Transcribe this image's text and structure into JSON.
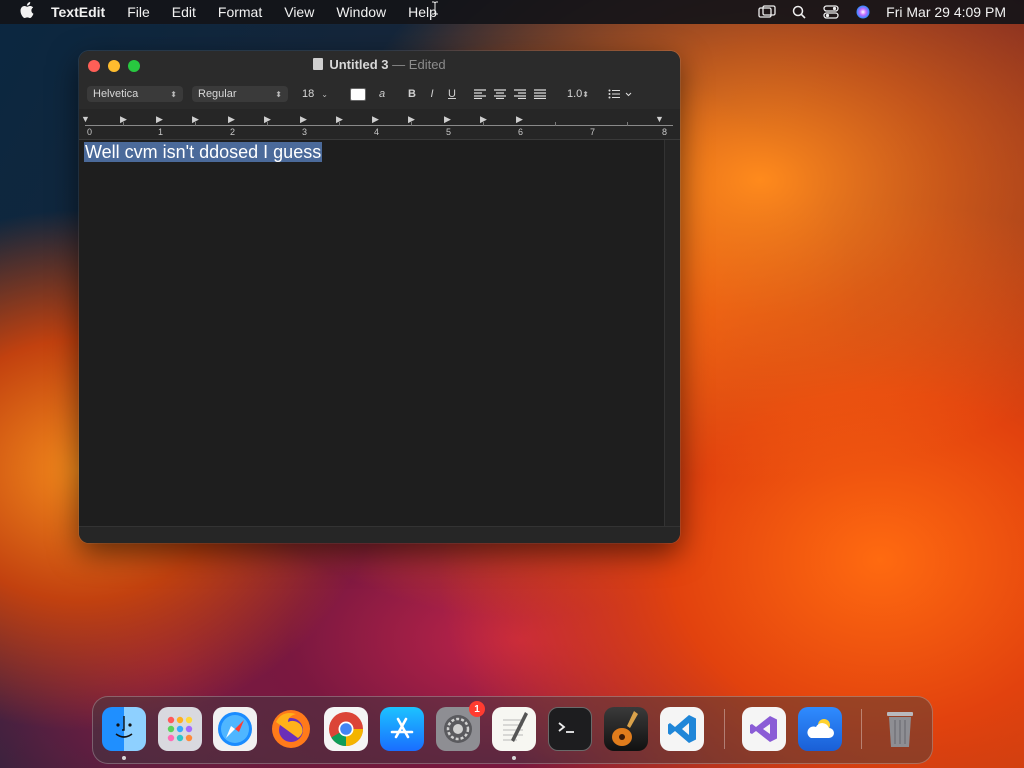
{
  "menubar": {
    "app_name": "TextEdit",
    "menus": [
      "File",
      "Edit",
      "Format",
      "View",
      "Window",
      "Help"
    ],
    "clock": "Fri Mar 29  4:09 PM",
    "status_icons": [
      "screen-mirroring-icon",
      "spotlight-search-icon",
      "control-center-icon",
      "siri-icon"
    ]
  },
  "window": {
    "title": "Untitled 3",
    "title_separator": "—",
    "status": "Edited",
    "toolbar": {
      "font_family": "Helvetica",
      "font_style": "Regular",
      "font_size": "18",
      "bold_label": "B",
      "italic_label": "I",
      "underline_label": "U",
      "line_spacing": "1.0"
    },
    "ruler_numbers": [
      "0",
      "1",
      "2",
      "3",
      "4",
      "5",
      "6",
      "7",
      "8"
    ],
    "document_text": "Well cvm isn't ddosed I guess"
  },
  "dock": {
    "items": [
      {
        "name": "Finder",
        "icon": "finder-icon",
        "running": true
      },
      {
        "name": "Launchpad",
        "icon": "launchpad-icon",
        "running": false
      },
      {
        "name": "Safari",
        "icon": "safari-icon",
        "running": false
      },
      {
        "name": "Firefox",
        "icon": "firefox-icon",
        "running": false
      },
      {
        "name": "Google Chrome",
        "icon": "chrome-icon",
        "running": false
      },
      {
        "name": "App Store",
        "icon": "app-store-icon",
        "running": false
      },
      {
        "name": "System Settings",
        "icon": "system-settings-icon",
        "running": false,
        "badge": "1"
      },
      {
        "name": "TextEdit",
        "icon": "textedit-icon",
        "running": true
      },
      {
        "name": "Terminal",
        "icon": "terminal-icon",
        "running": false
      },
      {
        "name": "GarageBand",
        "icon": "garageband-icon",
        "running": false
      },
      {
        "name": "Visual Studio Code",
        "icon": "vscode-icon",
        "running": false
      },
      {
        "name": "Visual Studio",
        "icon": "visual-studio-icon",
        "running": false
      },
      {
        "name": "Weather",
        "icon": "weather-icon",
        "running": false
      },
      {
        "name": "Trash",
        "icon": "trash-icon",
        "running": false
      }
    ]
  }
}
